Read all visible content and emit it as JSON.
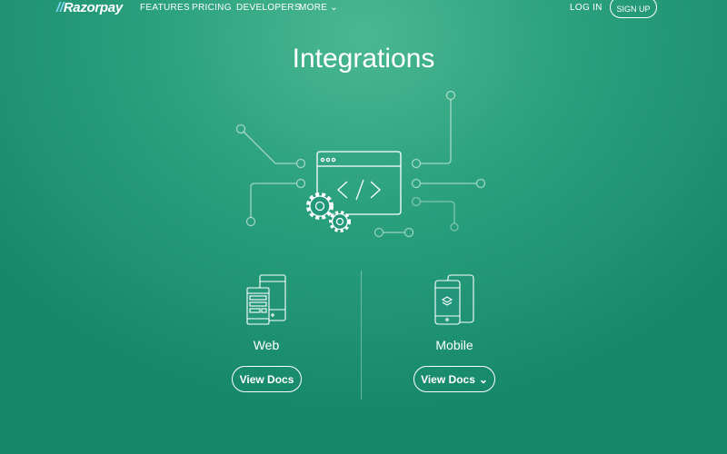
{
  "nav": {
    "logo": "Razorpay",
    "links": [
      "FEATURES",
      "PRICING",
      "DEVELOPERS",
      "MORE"
    ],
    "login": "LOG IN",
    "signup": "SIGN UP"
  },
  "page": {
    "title": "Integrations"
  },
  "cards": [
    {
      "label": "Web",
      "button": "View Docs"
    },
    {
      "label": "Mobile",
      "button": "View Docs"
    }
  ]
}
